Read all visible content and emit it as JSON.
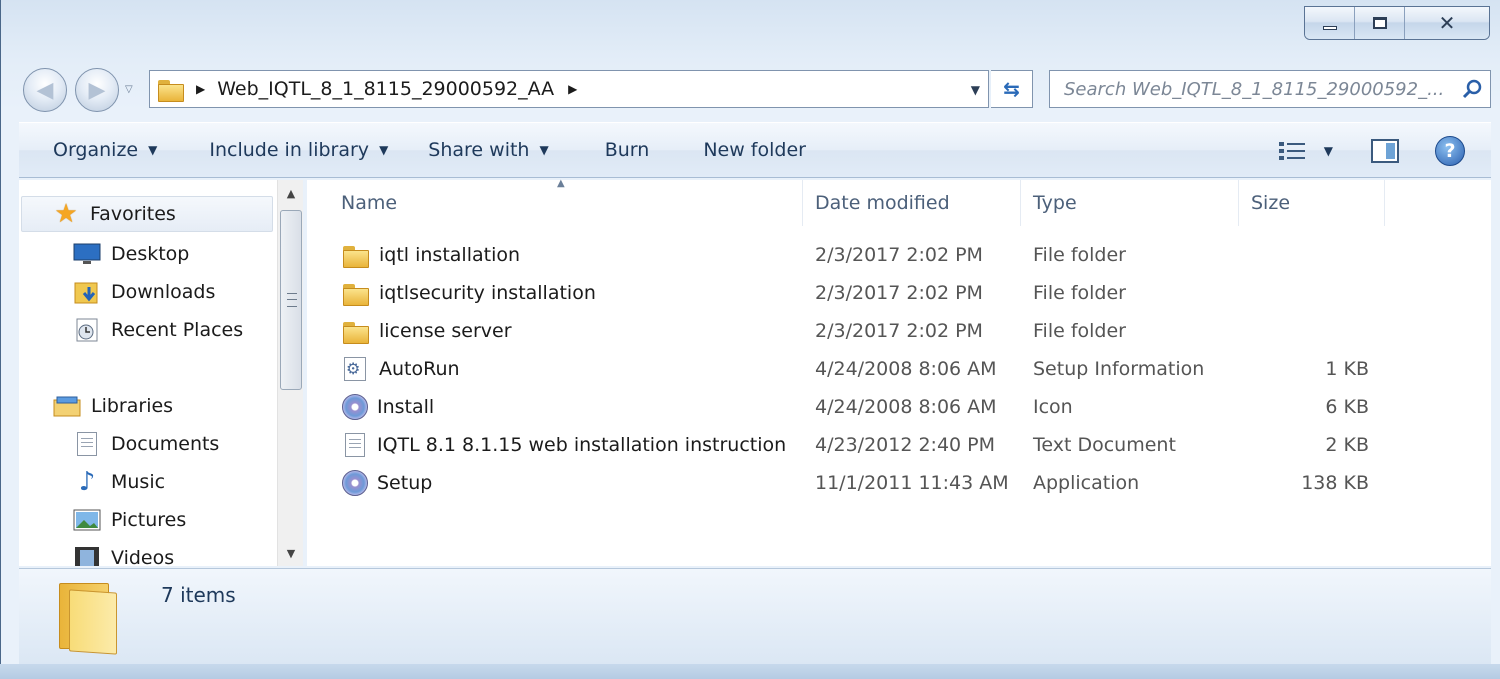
{
  "address": {
    "path": "Web_IQTL_8_1_8115_29000592_AA"
  },
  "search": {
    "placeholder": "Search Web_IQTL_8_1_8115_29000592_..."
  },
  "toolbar": {
    "organize": "Organize",
    "include_in_library": "Include in library",
    "share_with": "Share with",
    "burn": "Burn",
    "new_folder": "New folder"
  },
  "navpane": {
    "favorites": "Favorites",
    "desktop": "Desktop",
    "downloads": "Downloads",
    "recent_places": "Recent Places",
    "libraries": "Libraries",
    "documents": "Documents",
    "music": "Music",
    "pictures": "Pictures",
    "videos": "Videos"
  },
  "columns": {
    "name": "Name",
    "date_modified": "Date modified",
    "type": "Type",
    "size": "Size"
  },
  "files": [
    {
      "name": "iqtl installation",
      "date": "2/3/2017 2:02 PM",
      "type": "File folder",
      "size": "",
      "icon": "folder-icon"
    },
    {
      "name": "iqtlsecurity installation",
      "date": "2/3/2017 2:02 PM",
      "type": "File folder",
      "size": "",
      "icon": "folder-icon"
    },
    {
      "name": "license server",
      "date": "2/3/2017 2:02 PM",
      "type": "File folder",
      "size": "",
      "icon": "folder-icon"
    },
    {
      "name": "AutoRun",
      "date": "4/24/2008 8:06 AM",
      "type": "Setup Information",
      "size": "1 KB",
      "icon": "setup-info-icon"
    },
    {
      "name": "Install",
      "date": "4/24/2008 8:06 AM",
      "type": "Icon",
      "size": "6 KB",
      "icon": "disc-icon"
    },
    {
      "name": "IQTL 8.1 8.1.15 web installation instruction",
      "date": "4/23/2012 2:40 PM",
      "type": "Text Document",
      "size": "2 KB",
      "icon": "text-document-icon"
    },
    {
      "name": "Setup",
      "date": "11/1/2011 11:43 AM",
      "type": "Application",
      "size": "138 KB",
      "icon": "disc-icon"
    }
  ],
  "details": {
    "item_count": "7 items"
  },
  "colors": {
    "window_frame": "#a9c3de",
    "toolbar_text": "#1e395b",
    "accent": "#2a6ab8"
  }
}
